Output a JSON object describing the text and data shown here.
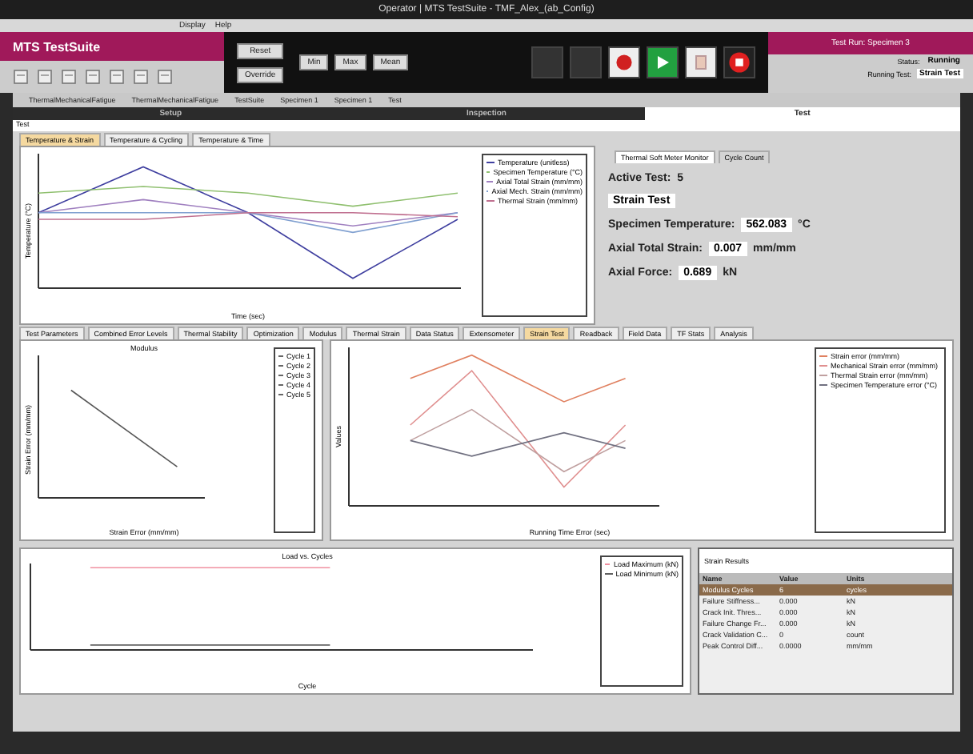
{
  "window": {
    "title": "Operator | MTS TestSuite - TMF_Alex_(ab_Config)"
  },
  "menu": [
    "Display",
    "Help"
  ],
  "app": {
    "name": "MTS TestSuite"
  },
  "controls": {
    "buttons": [
      "Reset",
      "Override"
    ],
    "small_buttons": [
      "Min",
      "Max",
      "Mean"
    ]
  },
  "status": {
    "test_run": "Test Run: Specimen 3",
    "status_label": "Status:",
    "status": "Running",
    "running_test_label": "Running Test:",
    "running_test": "Strain Test"
  },
  "breadcrumb": [
    "ThermalMechanicalFatigue",
    "ThermalMechanicalFatigue",
    "TestSuite",
    "Specimen 1",
    "Specimen 1",
    "Test"
  ],
  "main_tabs": [
    {
      "label": "Setup",
      "selected": false
    },
    {
      "label": "Inspection",
      "selected": false
    },
    {
      "label": "Test",
      "selected": true
    }
  ],
  "section": "Test",
  "top_tabs": [
    {
      "label": "Temperature & Strain",
      "selected": true
    },
    {
      "label": "Temperature & Cycling",
      "selected": false
    },
    {
      "label": "Temperature & Time",
      "selected": false
    }
  ],
  "top_chart": {
    "ylabel": "Temperature (°C)",
    "xlabel": "Time (sec)",
    "legend": [
      {
        "name": "Temperature (unitless)",
        "color": "#4040a0"
      },
      {
        "name": "Specimen Temperature (°C)",
        "color": "#90c070"
      },
      {
        "name": "Axial Total Strain (mm/mm)",
        "color": "#a080c0"
      },
      {
        "name": "Axial Mech. Strain (mm/mm)",
        "color": "#80a0d0"
      },
      {
        "name": "Thermal Strain (mm/mm)",
        "color": "#c07090"
      }
    ]
  },
  "monitor": {
    "tabs": [
      {
        "label": "Thermal Soft Meter Monitor",
        "selected": true
      },
      {
        "label": "Cycle Count",
        "selected": false
      }
    ],
    "active_test_label": "Active Test:",
    "active_test": "5",
    "test_name": "Strain Test",
    "readings": [
      {
        "label": "Specimen Temperature:",
        "value": "562.083",
        "unit": "°C"
      },
      {
        "label": "Axial Total Strain:",
        "value": "0.007",
        "unit": "mm/mm"
      },
      {
        "label": "Axial Force:",
        "value": "0.689",
        "unit": "kN"
      }
    ]
  },
  "lower_tabs": [
    {
      "label": "Test Parameters",
      "selected": false
    },
    {
      "label": "Combined Error Levels",
      "selected": false
    },
    {
      "label": "Thermal Stability",
      "selected": false
    },
    {
      "label": "Optimization",
      "selected": false
    },
    {
      "label": "Modulus",
      "selected": false
    },
    {
      "label": "Thermal Strain",
      "selected": false
    },
    {
      "label": "Data Status",
      "selected": false
    },
    {
      "label": "Extensometer",
      "selected": false
    },
    {
      "label": "Strain Test",
      "selected": true
    },
    {
      "label": "Readback",
      "selected": false
    },
    {
      "label": "Field Data",
      "selected": false
    },
    {
      "label": "TF Stats",
      "selected": false
    },
    {
      "label": "Analysis",
      "selected": false
    }
  ],
  "modulus_chart": {
    "title": "Modulus",
    "xlabel": "Strain Error (mm/mm)",
    "ylabel": "Strain Error (mm/mm)",
    "legend": [
      "Cycle 1",
      "Cycle 2",
      "Cycle 3",
      "Cycle 4",
      "Cycle 5"
    ]
  },
  "error_chart": {
    "xlabel": "Running Time Error (sec)",
    "ylabel": "Values",
    "legend": [
      {
        "name": "Strain error (mm/mm)",
        "color": "#e08060"
      },
      {
        "name": "Mechanical Strain error (mm/mm)",
        "color": "#e09090"
      },
      {
        "name": "Thermal Strain error (mm/mm)",
        "color": "#c0a0a0"
      },
      {
        "name": "Specimen Temperature error (°C)",
        "color": "#707080"
      }
    ]
  },
  "load_chart": {
    "title": "Load vs. Cycles",
    "xlabel": "Cycle",
    "legend": [
      {
        "name": "Load Maximum (kN)",
        "color": "#f090a0"
      },
      {
        "name": "Load Minimum (kN)",
        "color": "#606060"
      }
    ]
  },
  "results": {
    "title": "Strain Results",
    "columns": [
      "Name",
      "Value",
      "Units"
    ],
    "rows": [
      {
        "cells": [
          "Modulus Cycles",
          "6",
          "cycles"
        ],
        "selected": true
      },
      {
        "cells": [
          "Failure Stiffness...",
          "0.000",
          "kN"
        ],
        "selected": false
      },
      {
        "cells": [
          "Crack Init. Thres...",
          "0.000",
          "kN"
        ],
        "selected": false
      },
      {
        "cells": [
          "Failure Change Fr...",
          "0.000",
          "kN"
        ],
        "selected": false
      },
      {
        "cells": [
          "Crack Validation C...",
          "0",
          "count"
        ],
        "selected": false
      },
      {
        "cells": [
          "Peak Control Diff...",
          "0.0000",
          "mm/mm"
        ],
        "selected": false
      }
    ]
  }
}
